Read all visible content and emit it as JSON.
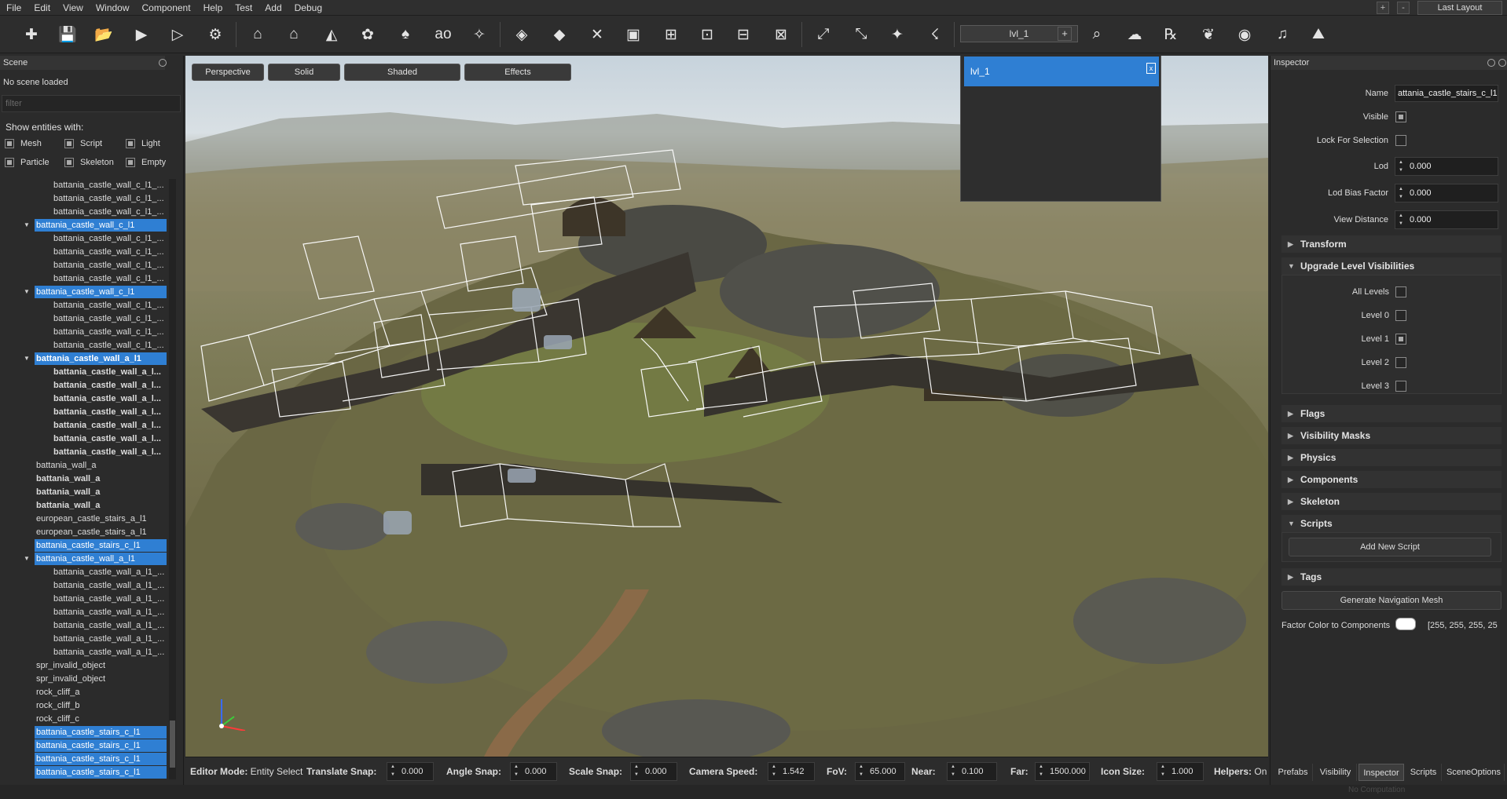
{
  "menu": [
    "File",
    "Edit",
    "View",
    "Window",
    "Component",
    "Help",
    "Test",
    "Add",
    "Debug"
  ],
  "window_controls": {
    "add": "+",
    "minimize": "-"
  },
  "layout_select": "Last Layout",
  "toolbar": {
    "icons": [
      "new-entity-icon",
      "save-icon",
      "open-folder-icon",
      "play-icon",
      "play-outline-icon",
      "prefab-icon",
      "house-icon",
      "house-2-icon",
      "roof-icon",
      "paint-icon",
      "tree-icon",
      "ao-icon",
      "wand-icon",
      "cube-icon",
      "cube-add-icon",
      "axes-icon",
      "box-icon",
      "mesh-icon",
      "grid-cube-icon",
      "mesh-add-icon",
      "mesh-add-2-icon",
      "path-icon",
      "path-2-icon",
      "spark-icon",
      "figure-icon",
      "zoom-icon",
      "cloud-gear-icon",
      "render-icon",
      "leaf-icon",
      "eye-icon",
      "sound-icon",
      "terrain-icon"
    ],
    "level_combo": "lvl_1",
    "level_add": "+"
  },
  "scene_panel": {
    "title": "Scene",
    "status": "No scene loaded",
    "filter_placeholder": "filter",
    "show_entities_label": "Show entities with:",
    "entity_filters": [
      "Mesh",
      "Script",
      "Light",
      "Particle",
      "Skeleton",
      "Empty"
    ],
    "tree": [
      {
        "label": "battania_castle_wall_c_l1_...",
        "indent": 2,
        "sel": false,
        "bold": false
      },
      {
        "label": "battania_castle_wall_c_l1_...",
        "indent": 2,
        "sel": false,
        "bold": false
      },
      {
        "label": "battania_castle_wall_c_l1_...",
        "indent": 2,
        "sel": false,
        "bold": false
      },
      {
        "label": "battania_castle_wall_c_l1",
        "indent": 1,
        "sel": true,
        "bold": false,
        "arrow": true
      },
      {
        "label": "battania_castle_wall_c_l1_...",
        "indent": 2,
        "sel": false,
        "bold": false
      },
      {
        "label": "battania_castle_wall_c_l1_...",
        "indent": 2,
        "sel": false,
        "bold": false
      },
      {
        "label": "battania_castle_wall_c_l1_...",
        "indent": 2,
        "sel": false,
        "bold": false
      },
      {
        "label": "battania_castle_wall_c_l1_...",
        "indent": 2,
        "sel": false,
        "bold": false
      },
      {
        "label": "battania_castle_wall_c_l1",
        "indent": 1,
        "sel": true,
        "bold": false,
        "arrow": true
      },
      {
        "label": "battania_castle_wall_c_l1_...",
        "indent": 2,
        "sel": false,
        "bold": false
      },
      {
        "label": "battania_castle_wall_c_l1_...",
        "indent": 2,
        "sel": false,
        "bold": false
      },
      {
        "label": "battania_castle_wall_c_l1_...",
        "indent": 2,
        "sel": false,
        "bold": false
      },
      {
        "label": "battania_castle_wall_c_l1_...",
        "indent": 2,
        "sel": false,
        "bold": false
      },
      {
        "label": "battania_castle_wall_a_l1",
        "indent": 1,
        "sel": true,
        "bold": true,
        "arrow": true
      },
      {
        "label": "battania_castle_wall_a_l...",
        "indent": 2,
        "sel": false,
        "bold": true
      },
      {
        "label": "battania_castle_wall_a_l...",
        "indent": 2,
        "sel": false,
        "bold": true
      },
      {
        "label": "battania_castle_wall_a_l...",
        "indent": 2,
        "sel": false,
        "bold": true
      },
      {
        "label": "battania_castle_wall_a_l...",
        "indent": 2,
        "sel": false,
        "bold": true
      },
      {
        "label": "battania_castle_wall_a_l...",
        "indent": 2,
        "sel": false,
        "bold": true
      },
      {
        "label": "battania_castle_wall_a_l...",
        "indent": 2,
        "sel": false,
        "bold": true
      },
      {
        "label": "battania_castle_wall_a_l...",
        "indent": 2,
        "sel": false,
        "bold": true
      },
      {
        "label": "battania_wall_a",
        "indent": 1,
        "sel": false,
        "bold": false
      },
      {
        "label": "battania_wall_a",
        "indent": 1,
        "sel": false,
        "bold": true
      },
      {
        "label": "battania_wall_a",
        "indent": 1,
        "sel": false,
        "bold": true
      },
      {
        "label": "battania_wall_a",
        "indent": 1,
        "sel": false,
        "bold": true
      },
      {
        "label": "european_castle_stairs_a_l1",
        "indent": 1,
        "sel": false,
        "bold": false
      },
      {
        "label": "european_castle_stairs_a_l1",
        "indent": 1,
        "sel": false,
        "bold": false
      },
      {
        "label": "battania_castle_stairs_c_l1",
        "indent": 1,
        "sel": true,
        "bold": false
      },
      {
        "label": "battania_castle_wall_a_l1",
        "indent": 1,
        "sel": true,
        "bold": false,
        "arrow": true
      },
      {
        "label": "battania_castle_wall_a_l1_...",
        "indent": 2,
        "sel": false,
        "bold": false
      },
      {
        "label": "battania_castle_wall_a_l1_...",
        "indent": 2,
        "sel": false,
        "bold": false
      },
      {
        "label": "battania_castle_wall_a_l1_...",
        "indent": 2,
        "sel": false,
        "bold": false
      },
      {
        "label": "battania_castle_wall_a_l1_...",
        "indent": 2,
        "sel": false,
        "bold": false
      },
      {
        "label": "battania_castle_wall_a_l1_...",
        "indent": 2,
        "sel": false,
        "bold": false
      },
      {
        "label": "battania_castle_wall_a_l1_...",
        "indent": 2,
        "sel": false,
        "bold": false
      },
      {
        "label": "battania_castle_wall_a_l1_...",
        "indent": 2,
        "sel": false,
        "bold": false
      },
      {
        "label": "spr_invalid_object",
        "indent": 1,
        "sel": false,
        "bold": false
      },
      {
        "label": "spr_invalid_object",
        "indent": 1,
        "sel": false,
        "bold": false
      },
      {
        "label": "rock_cliff_a",
        "indent": 1,
        "sel": false,
        "bold": false
      },
      {
        "label": "rock_cliff_b",
        "indent": 1,
        "sel": false,
        "bold": false
      },
      {
        "label": "rock_cliff_c",
        "indent": 1,
        "sel": false,
        "bold": false
      },
      {
        "label": "battania_castle_stairs_c_l1",
        "indent": 1,
        "sel": true,
        "bold": false
      },
      {
        "label": "battania_castle_stairs_c_l1",
        "indent": 1,
        "sel": true,
        "bold": false
      },
      {
        "label": "battania_castle_stairs_c_l1",
        "indent": 1,
        "sel": true,
        "bold": false
      },
      {
        "label": "battania_castle_stairs_c_l1",
        "indent": 1,
        "sel": true,
        "bold": false
      }
    ]
  },
  "viewport": {
    "tabs": [
      "Perspective",
      "Solid",
      "Shaded",
      "Effects"
    ],
    "level_popup_item": "lvl_1",
    "level_popup_close": "x"
  },
  "statusbar": {
    "editor_mode_label": "Editor Mode:",
    "editor_mode_value": "Entity Select",
    "translate_snap_label": "Translate Snap:",
    "translate_snap": "0.000",
    "angle_snap_label": "Angle Snap:",
    "angle_snap": "0.000",
    "scale_snap_label": "Scale Snap:",
    "scale_snap": "0.000",
    "camera_speed_label": "Camera Speed:",
    "camera_speed": "1.542",
    "fov_label": "FoV:",
    "fov": "65.000",
    "near_label": "Near:",
    "near": "0.100",
    "far_label": "Far:",
    "far": "1500.000",
    "icon_size_label": "Icon Size:",
    "icon_size": "1.000",
    "helpers_label": "Helpers:",
    "helpers_value": "On"
  },
  "inspector": {
    "title": "Inspector",
    "name_label": "Name",
    "name_value": "attania_castle_stairs_c_l1",
    "visible_label": "Visible",
    "lock_label": "Lock For Selection",
    "lod_label": "Lod",
    "lod_value": "0.000",
    "lod_bias_label": "Lod Bias Factor",
    "lod_bias_value": "0.000",
    "view_distance_label": "View Distance",
    "view_distance_value": "0.000",
    "transform": "Transform",
    "upgrade_levels": "Upgrade Level Visibilities",
    "levels": [
      "All Levels",
      "Level 0",
      "Level 1",
      "Level 2",
      "Level 3"
    ],
    "flags": "Flags",
    "visibility_masks": "Visibility Masks",
    "physics": "Physics",
    "components": "Components",
    "skeleton": "Skeleton",
    "scripts": "Scripts",
    "add_script": "Add New Script",
    "tags": "Tags",
    "gen_navmesh": "Generate Navigation Mesh",
    "factor_color_label": "Factor Color to Components",
    "factor_color_value": "[255, 255, 255, 25"
  },
  "bottom_tabs": [
    "Prefabs",
    "Visibility",
    "Inspector",
    "Scripts",
    "SceneOptions"
  ],
  "app_status": "No Computation",
  "colors": {
    "selection": "#2f7fd3",
    "panel": "#2b2b2b",
    "header": "#343434"
  }
}
